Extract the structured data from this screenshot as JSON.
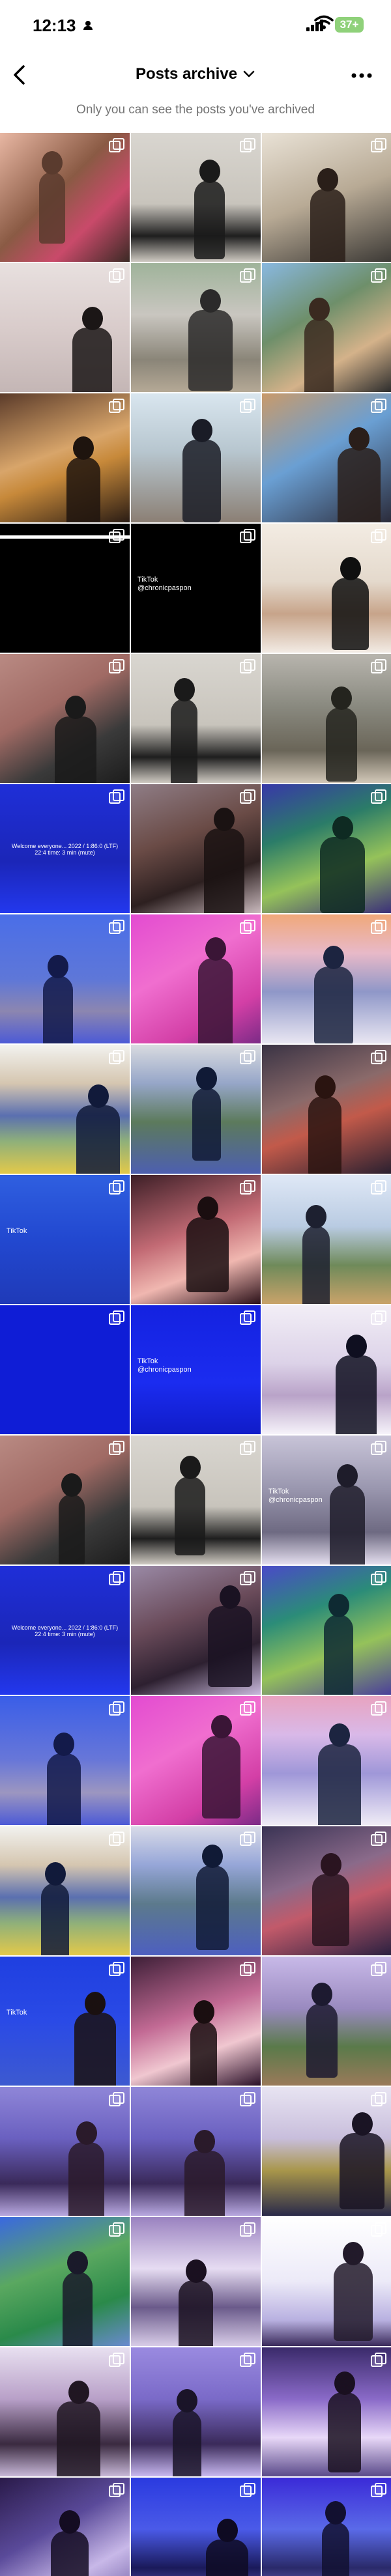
{
  "status_bar": {
    "time": "12:13",
    "battery": "37+",
    "battery_color": "#8fd17a"
  },
  "nav": {
    "title": "Posts archive",
    "back_icon": "chevron-left-icon",
    "more_icon": "more-horizontal-icon",
    "dropdown_icon": "chevron-down-icon"
  },
  "subtitle": "Only you can see the posts you've archived",
  "grid": {
    "columns": 3,
    "posts": [
      {
        "bg": "linear-gradient(135deg,#e8b7a3,#8a5a44 45%,#c94a6a 70%,#3b2a25)",
        "figure": "#5a3b2e"
      },
      {
        "bg": "linear-gradient(180deg,#d9d6d0,#c8c4bc 55%,#1e1e1e 80%,#cfcac2)",
        "figure": "#1a1a1a"
      },
      {
        "bg": "linear-gradient(160deg,#e9e2d6,#b8aa95 50%,#3d3a36)",
        "figure": "#2a1f19"
      },
      {
        "bg": "linear-gradient(180deg,#e8e0df,#d9cccb 50%,#c4b6b5)",
        "figure": "#1b1616"
      },
      {
        "bg": "linear-gradient(180deg,#9fb39a,#c9c6c0 40%,#8a8578 75%,#b5a996)",
        "figure": "#2b2a2a"
      },
      {
        "bg": "linear-gradient(150deg,#89b8e0,#6e8f6a 40%,#d4b28a 70%,#2c2c2c)",
        "figure": "#3a2a20"
      },
      {
        "bg": "linear-gradient(160deg,#5b3b2a,#d8a56a 45%,#c7893a 60%,#2a1c14)",
        "figure": "#1e140e"
      },
      {
        "bg": "linear-gradient(180deg,#d9e6ef,#b7c6cf 45%,#8b7f74)",
        "figure": "#1a1c26"
      },
      {
        "bg": "linear-gradient(150deg,#c99a6a,#6a9fd3 45%,#2b2b3a)",
        "figure": "#2a1e1a"
      },
      {
        "bg": "#000000",
        "line": true
      },
      {
        "bg": "#000000",
        "tiktok": "TikTok\n@chronicpaspon"
      },
      {
        "bg": "linear-gradient(180deg,#f3ece3,#e4d9cc 45%,#c7a48a 70%,#f2ebe4)",
        "figure": "#0f0f0f"
      },
      {
        "bg": "linear-gradient(150deg,#b98a83,#a06a64 40%,#3a3a3a 70%,#1c1c1c)",
        "figure": "#1a1a1a"
      },
      {
        "bg": "linear-gradient(180deg,#d9d6d0,#c8c4bc 55%,#1e1e1e 80%,#cfcac2)",
        "figure": "#1a1a1a"
      },
      {
        "bg": "linear-gradient(180deg,#b8b5ae,#8a8a80 40%,#6a6558 75%,#d2c8b8)",
        "figure": "#24241e"
      },
      {
        "bg": "linear-gradient(180deg,#1f2fd8,#1b26b8 60%,#2338ee)",
        "caption": "Welcome everyone... 2022 / 1:86:0 (LTF) 22:4 time: 3 min (mute)"
      },
      {
        "bg": "linear-gradient(160deg,#8f7d86,#6a4b46 40%,#2d2020 70%,#c9b9bd)",
        "figure": "#1a1212"
      },
      {
        "bg": "linear-gradient(160deg,#3838a8,#2b7c68 35%,#95c25a 65%,#3b2f7a)",
        "figure": "#0e2a22"
      },
      {
        "bg": "linear-gradient(180deg,#4a6ee8,#5e77d8 50%,#8c86b0 75%,#4c5ad6)",
        "figure": "#131a4a"
      },
      {
        "bg": "linear-gradient(150deg,#e34bd1,#f06ecf 40%,#d33fa6 75%,#7b2b86)",
        "figure": "#3a1536"
      },
      {
        "bg": "linear-gradient(180deg,#f0a87a,#e8b9c8 30%,#8f97c8 60%,#e9e6f2)",
        "figure": "#1c2440"
      },
      {
        "bg": "linear-gradient(180deg,#f2f2ef,#d5c6b0 30%,#5a6fb0 55%,#8fb07a 75%,#e3c94a)",
        "figure": "#111a3a"
      },
      {
        "bg": "linear-gradient(180deg,#d9dbe0,#96a6c8 30%,#5c7a5c 60%,#4d5fb0)",
        "figure": "#101a36"
      },
      {
        "bg": "linear-gradient(160deg,#3a3344,#8a6a6a 40%,#c25a4a 60%,#2a2030)",
        "figure": "#2a1410"
      },
      {
        "bg": "linear-gradient(180deg,#2f5fe0,#2248d0 50%,#1f3ab8)",
        "tiktok": "TikTok"
      },
      {
        "bg": "linear-gradient(160deg,#3d1f27,#c26a74 45%,#f0b7b0 70%,#2a1018)",
        "figure": "#1a0e10"
      },
      {
        "bg": "linear-gradient(180deg,#dfe8f6,#b9cbe2 40%,#6f8a5a 70%,#c9a36a)",
        "figure": "#1d2030"
      },
      {
        "bg": "#0f1dd6",
        "line": false
      },
      {
        "bg": "linear-gradient(180deg,#1422e0,#1b2cf0 60%,#101cc8)",
        "tiktok": "TikTok\n@chronicpaspon"
      },
      {
        "bg": "linear-gradient(180deg,#f2eef6,#dcd2e8 45%,#b9a3c8 70%,#f6f3fa)",
        "figure": "#0f0f20"
      },
      {
        "bg": "linear-gradient(150deg,#b98a83,#a06a64 40%,#3a3a3a 70%,#1c1c1c)",
        "figure": "#1a1a1a"
      },
      {
        "bg": "linear-gradient(180deg,#d9d6d0,#c8c4bc 55%,#1e1e1e 80%,#cfcac2)",
        "figure": "#1a1a1a"
      },
      {
        "bg": "linear-gradient(180deg,#c8c4d8,#9b98b0 40%,#6e6a82 75%,#e4deee)",
        "figure": "#1e1c2a",
        "tiktok": "TikTok\n@chronicpaspon"
      },
      {
        "bg": "linear-gradient(180deg,#1f2fd8,#1b26b8 60%,#2338ee)",
        "caption": "Welcome everyone... 2022 / 1:86:0 (LTF) 22:4 time: 3 min (mute)"
      },
      {
        "bg": "linear-gradient(160deg,#9a8aa6,#6a4b5a 40%,#2d2030 70%,#c9b9dd)",
        "figure": "#1a1222"
      },
      {
        "bg": "linear-gradient(160deg,#4a4ac8,#2b8c78 35%,#95c25a 65%,#4b3f9a)",
        "figure": "#0e2a32"
      },
      {
        "bg": "linear-gradient(180deg,#3a5ee8,#6877d8 50%,#9c96c0 75%,#4c5ad6)",
        "figure": "#131a4a"
      },
      {
        "bg": "linear-gradient(150deg,#e34bd1,#f06ecf 40%,#d33fa6 75%,#7b2b86)",
        "figure": "#3a1536"
      },
      {
        "bg": "linear-gradient(180deg,#e8a3c0,#d9b9e8 30%,#9f97d8 60%,#f0ecf6)",
        "figure": "#1c2440"
      },
      {
        "bg": "linear-gradient(180deg,#f2f2ef,#d5c6b0 30%,#5a6fb0 55%,#8fb07a 75%,#e3c94a)",
        "figure": "#111a3a"
      },
      {
        "bg": "linear-gradient(180deg,#d9dbe8,#96a6d8 30%,#5c7a8c 60%,#4d5fc0)",
        "figure": "#101a36"
      },
      {
        "bg": "linear-gradient(160deg,#3a3354,#8a6a8a 40%,#c25a6a 60%,#2a2040)",
        "figure": "#2a1420"
      },
      {
        "bg": "linear-gradient(180deg,#1f3fe0,#2a4ae6 50%,#3d5ad0)",
        "figure": "#1a1010",
        "tiktok": "TikTok"
      },
      {
        "bg": "linear-gradient(160deg,#3d1f37,#c26a94 45%,#f0c7d0 70%,#2a1028)",
        "figure": "#1a0e10"
      },
      {
        "bg": "linear-gradient(180deg,#c8b9e8,#9a8ac0 40%,#5a7a4a 70%,#9a7a5a)",
        "figure": "#1d1a30"
      },
      {
        "bg": "linear-gradient(180deg,#8f86d8,#6a60c0 40%,#3a2a5a 75%,#b8a8e0)",
        "figure": "#2a1a2a"
      },
      {
        "bg": "linear-gradient(180deg,#8f86d8,#6a60c0 40%,#3a2a5a 75%,#b8a8e0)",
        "figure": "#2a1a2a"
      },
      {
        "bg": "linear-gradient(180deg,#e8e4f2,#c8bedc 40%,#a8964a 65%,#2a2a4a)",
        "figure": "#1a1424"
      },
      {
        "bg": "linear-gradient(160deg,#3a68e0,#5aa860 40%,#2a8a4a 70%,#6a8ad0)",
        "figure": "#1a1a2a"
      },
      {
        "bg": "linear-gradient(180deg,#9a82c0,#e6dcf2 40%,#6a5a8a 70%,#d8cce8)",
        "figure": "#1a1020"
      },
      {
        "bg": "linear-gradient(180deg,#ffffff,#eceaf8 50%,#b8b0e0 80%,#3a2a5a)",
        "figure": "#221a2a"
      },
      {
        "bg": "linear-gradient(180deg,#e8e0f0,#b8a0c8 40%,#3a2a40 75%,#c8b8d8)",
        "figure": "#201622"
      },
      {
        "bg": "linear-gradient(180deg,#9a8ae0,#7a6ac8 40%,#3a2a5a 75%,#c8b8f0)",
        "figure": "#1a1428"
      },
      {
        "bg": "linear-gradient(180deg,#3a2a6a,#8a6ac8 40%,#e8d8f8 70%,#5a4a8a)",
        "figure": "#1a1020"
      },
      {
        "bg": "linear-gradient(150deg,#2a1a4a,#5a4a9a 40%,#c8b8e8 70%,#6a5aa0)",
        "figure": "#140c22"
      },
      {
        "bg": "linear-gradient(180deg,#2a3ae0,#4a5ae8 40%,#1a1a5a 70%,#7a6ad8)",
        "figure": "#0e0a22"
      },
      {
        "bg": "linear-gradient(180deg,#3a2ad8,#5a6ae8 40%,#2a2a6a 70%,#8a7ae0)",
        "figure": "#121030"
      }
    ]
  }
}
